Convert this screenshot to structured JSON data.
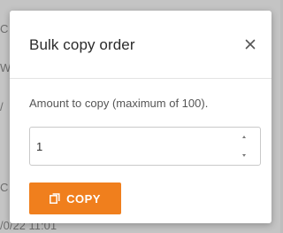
{
  "modal": {
    "title": "Bulk copy order",
    "close_icon": "close-icon"
  },
  "form": {
    "amount_label": "Amount to copy (maximum of 100).",
    "amount_value": "1",
    "spinner_up_icon": "chevron-up-icon",
    "spinner_down_icon": "chevron-down-icon"
  },
  "actions": {
    "copy_label": "COPY",
    "copy_icon": "copy-icon",
    "copy_color": "#f07f1d"
  },
  "background": {
    "fragments": [
      "C",
      "W",
      "/",
      "C",
      "/0/22 11:01"
    ]
  }
}
